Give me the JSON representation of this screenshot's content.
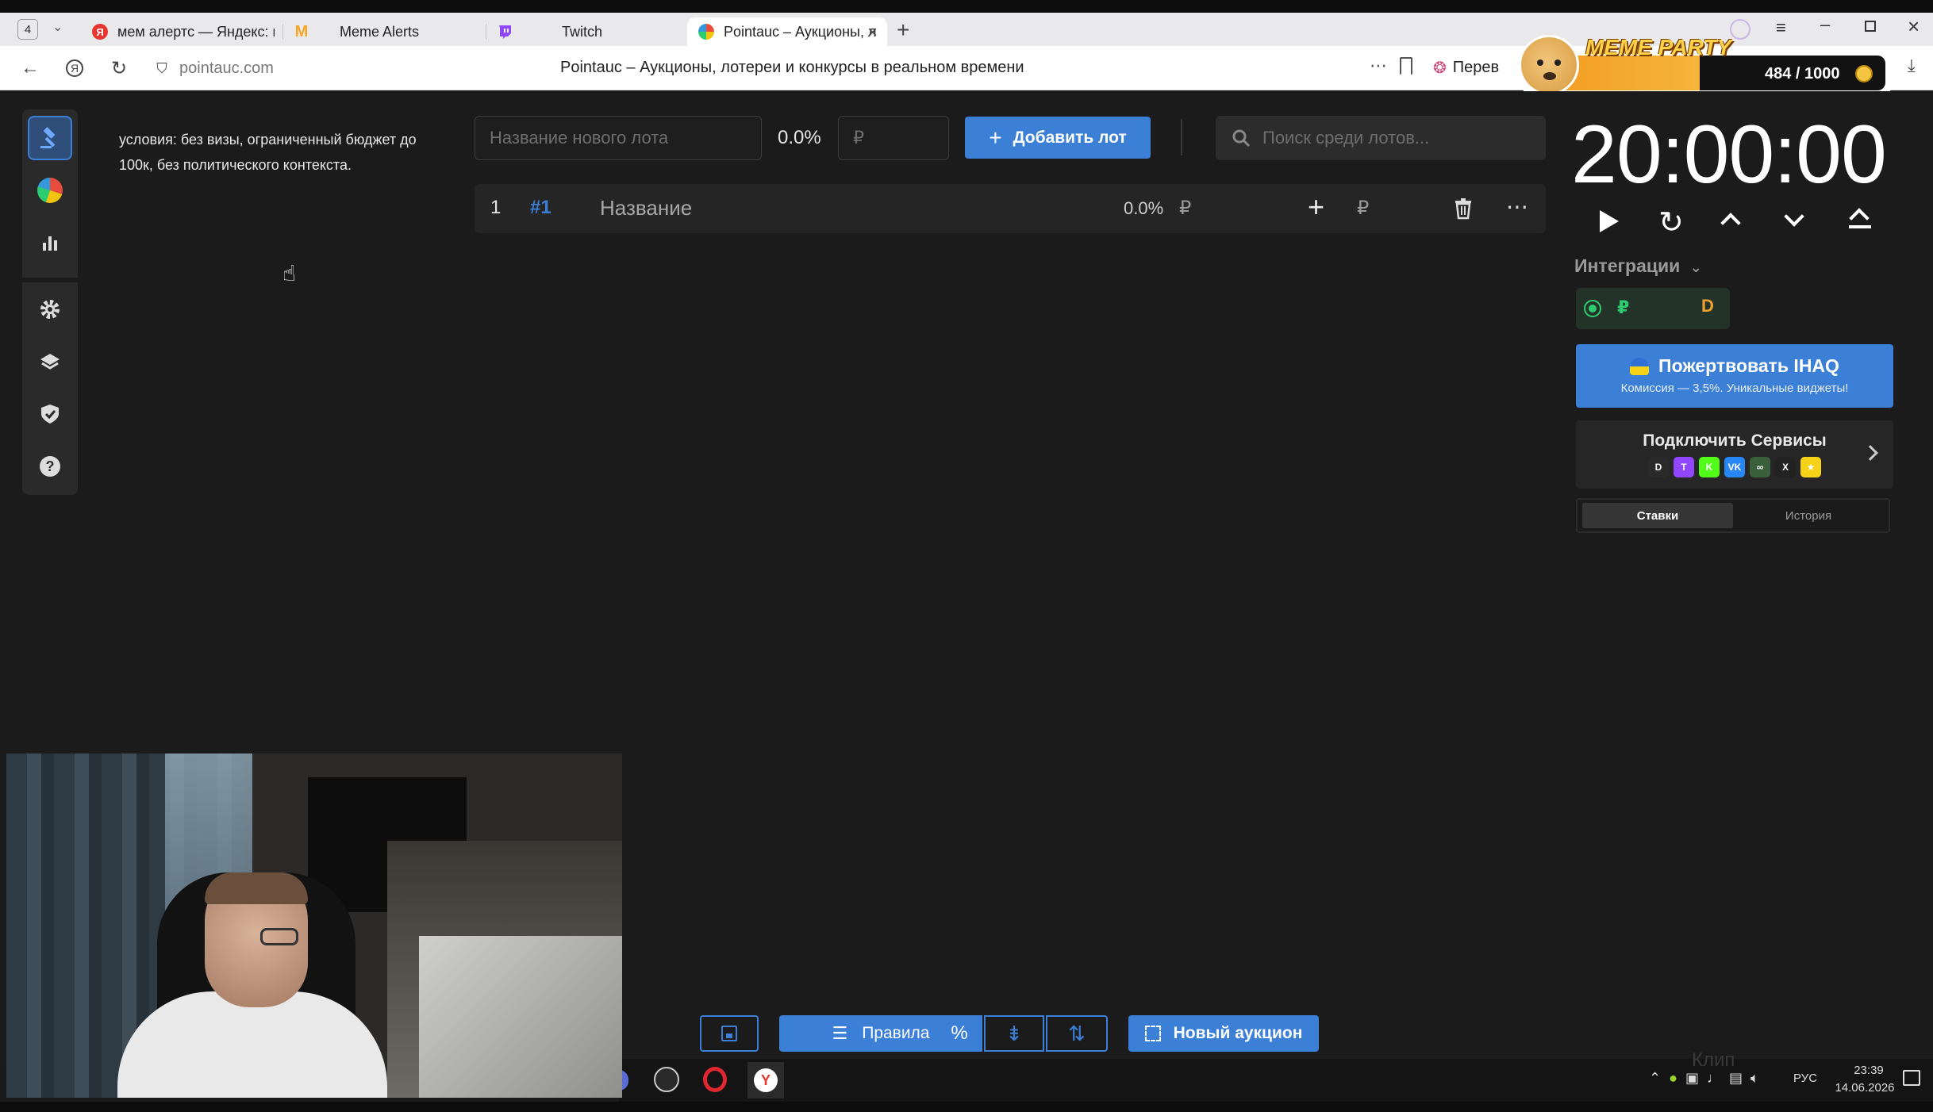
{
  "browser": {
    "tab_counter": "4",
    "tabs": [
      {
        "title": "мем алертс — Яндекс: на",
        "icon": "yandex-icon",
        "color": "#e8362f"
      },
      {
        "title": "Meme Alerts",
        "icon": "meme-alerts-icon",
        "color": "#f5a623"
      },
      {
        "title": "Twitch",
        "icon": "twitch-icon",
        "color": "#9146ff"
      },
      {
        "title": "Pointauc – Аукционы, л",
        "icon": "pointauc-icon",
        "color": "#333333"
      }
    ],
    "url": "pointauc.com",
    "page_title": "Pointauc – Аукционы, лотереи и конкурсы в реальном времени",
    "translate_label": "Перев"
  },
  "overlay": {
    "meme_party_label": "MEME PARTY",
    "counter": "484 / 1000"
  },
  "app": {
    "rules_text": "условия: без визы, ограниченный бюджет до 100к, без политического контекста.",
    "new_lot_placeholder": "Название нового лота",
    "new_lot_percent": "0.0%",
    "new_lot_amount_placeholder": "₽",
    "add_lot_label": "Добавить лот",
    "search_placeholder": "Поиск среди лотов...",
    "lots": [
      {
        "index": "1",
        "id": "#1",
        "name": "Название",
        "percent": "0.0%",
        "currency": "₽",
        "add_currency": "₽"
      }
    ],
    "timer": "20:00:00",
    "integrations_label": "Интеграции",
    "integration_currency": "₽",
    "integration_badge": "D",
    "donate": {
      "title": "Пожертвовать IHAQ",
      "subtitle": "Комиссия — 3,5%. Уникальные виджеты!"
    },
    "connect_services_label": "Подключить Сервисы",
    "service_icons": [
      {
        "name": "donationalerts-icon",
        "color": "#2a2a2a",
        "glyph": "D"
      },
      {
        "name": "twitch-icon",
        "color": "#9146ff",
        "glyph": "T"
      },
      {
        "name": "kick-icon",
        "color": "#53fc18",
        "glyph": "K"
      },
      {
        "name": "vk-icon",
        "color": "#2787f5",
        "glyph": "VK"
      },
      {
        "name": "infinity-icon",
        "color": "#3a5f3a",
        "glyph": "∞"
      },
      {
        "name": "x-icon",
        "color": "#222222",
        "glyph": "X"
      },
      {
        "name": "star-icon",
        "color": "#f5d218",
        "glyph": "★"
      }
    ],
    "tabs_right": [
      "Ставки",
      "История"
    ],
    "bottom_toolbar": {
      "rules_label": "Правила",
      "new_auction_label": "Новый аукцион"
    }
  },
  "taskbar": {
    "clip_label": "Клип",
    "language": "РУС",
    "time": "23:39",
    "date": "14.06.2026"
  },
  "colors": {
    "accent": "#3b7fd6",
    "app_bg": "#1b1b1b",
    "panel_bg": "#2a2a2a",
    "lot_id": "#3b7fd6"
  }
}
